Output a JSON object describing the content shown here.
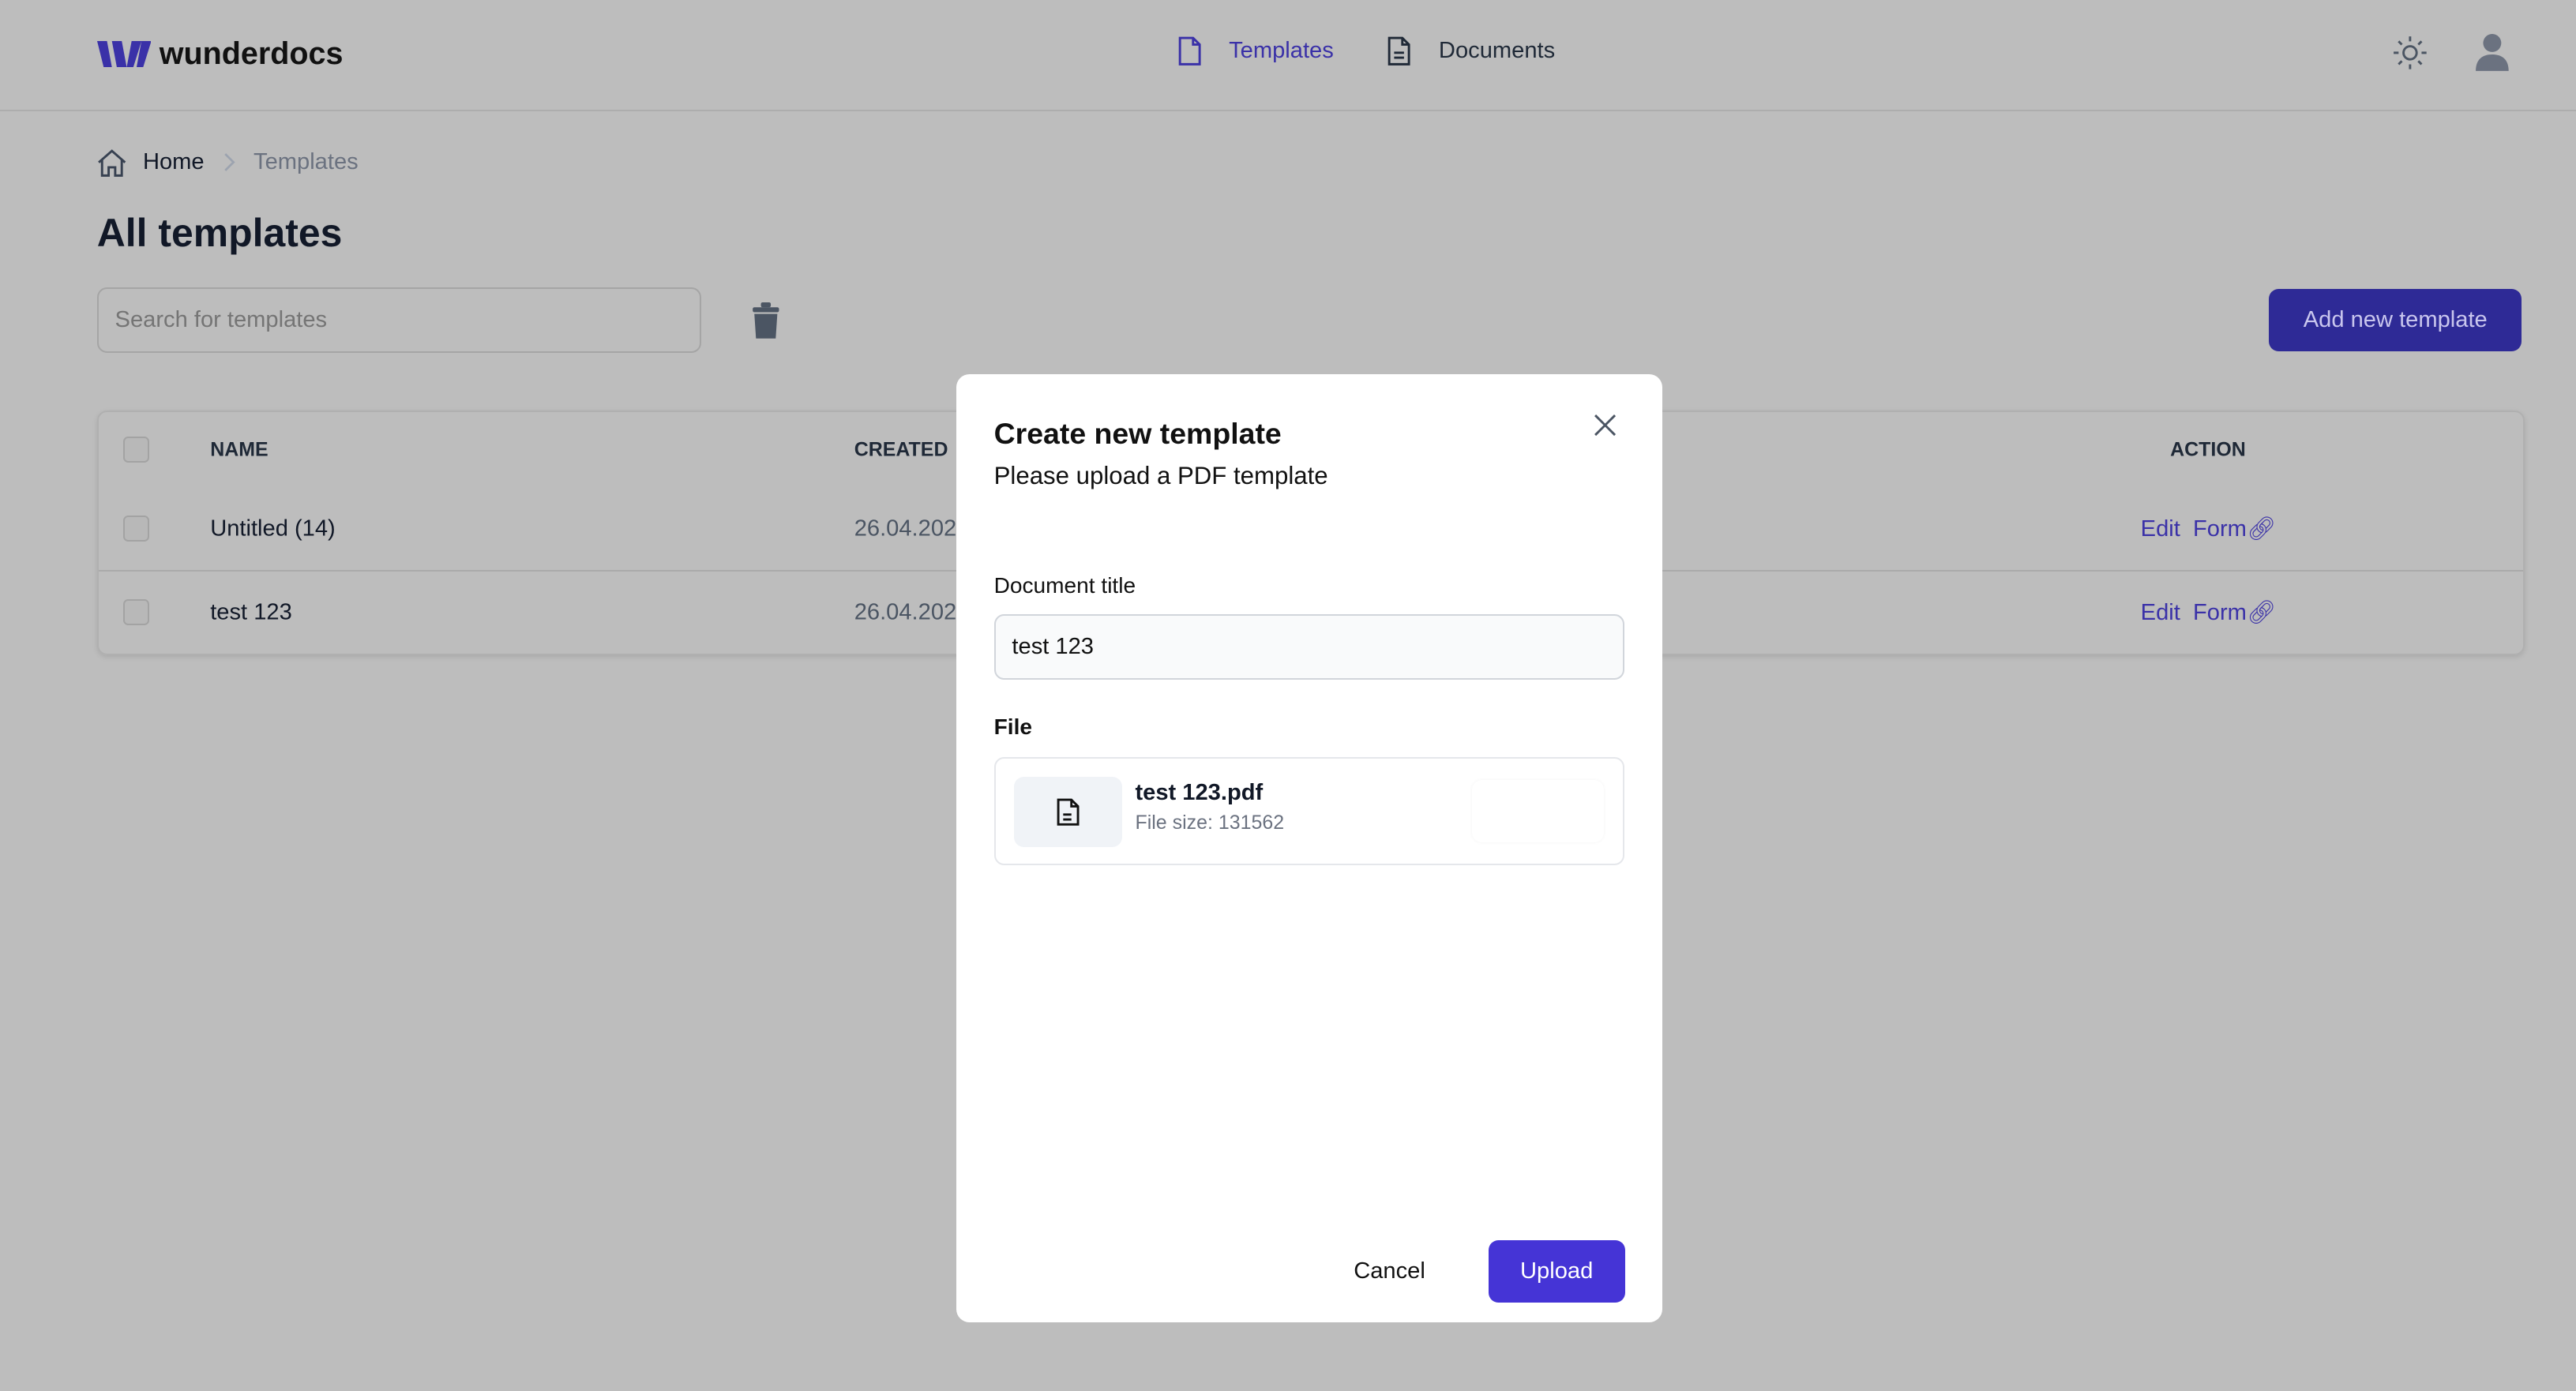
{
  "app": {
    "name": "wunderdocs",
    "brand_color": "#3a31a8"
  },
  "nav": [
    {
      "label": "Templates",
      "icon": "file-icon",
      "active": true
    },
    {
      "label": "Documents",
      "icon": "file-text-icon",
      "active": false
    }
  ],
  "header_icons": [
    "sun-icon",
    "user-icon"
  ],
  "breadcrumb": {
    "home": "Home",
    "current": "Templates"
  },
  "page": {
    "title": "All templates",
    "search_placeholder": "Search for templates",
    "add_button": "Add new template"
  },
  "table": {
    "headers": {
      "name": "NAME",
      "created": "CREATED",
      "action": "ACTION"
    },
    "rows": [
      {
        "name": "Untitled (14)",
        "created": "26.04.202",
        "edit": "Edit",
        "form": "Form"
      },
      {
        "name": "test 123",
        "created": "26.04.202",
        "edit": "Edit",
        "form": "Form"
      }
    ]
  },
  "modal": {
    "title": "Create new template",
    "subtitle": "Please upload a PDF template",
    "doc_title_label": "Document title",
    "doc_title_value": "test 123",
    "file_label": "File",
    "file_name": "test 123.pdf",
    "file_size": "File size: 131562",
    "cancel": "Cancel",
    "upload": "Upload"
  }
}
